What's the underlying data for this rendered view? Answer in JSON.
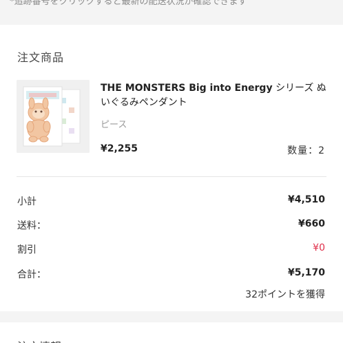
{
  "tracking_note": "*追跡番号をクリックすると最新の配送状況が確認できます",
  "order_items": {
    "section_title": "注文商品",
    "product": {
      "name_en": "THE MONSTERS Big into Energy",
      "name_jp": " シリーズ ぬいぐるみペンダント",
      "variant": "ピース",
      "price": "¥2,255",
      "quantity": "数量：2"
    }
  },
  "summary": {
    "subtotal_label": "小計",
    "subtotal_value": "¥4,510",
    "shipping_label": "送料：",
    "shipping_value": "¥660",
    "discount_label": "割引",
    "discount_value": "¥0",
    "total_label": "合計：",
    "total_value": "¥5,170",
    "points": "32ポイントを獲得"
  },
  "next_section": {
    "title": "注文情報"
  },
  "colors": {
    "discount": "#e0304b",
    "background": "#f4f4f4",
    "card": "#ffffff"
  }
}
